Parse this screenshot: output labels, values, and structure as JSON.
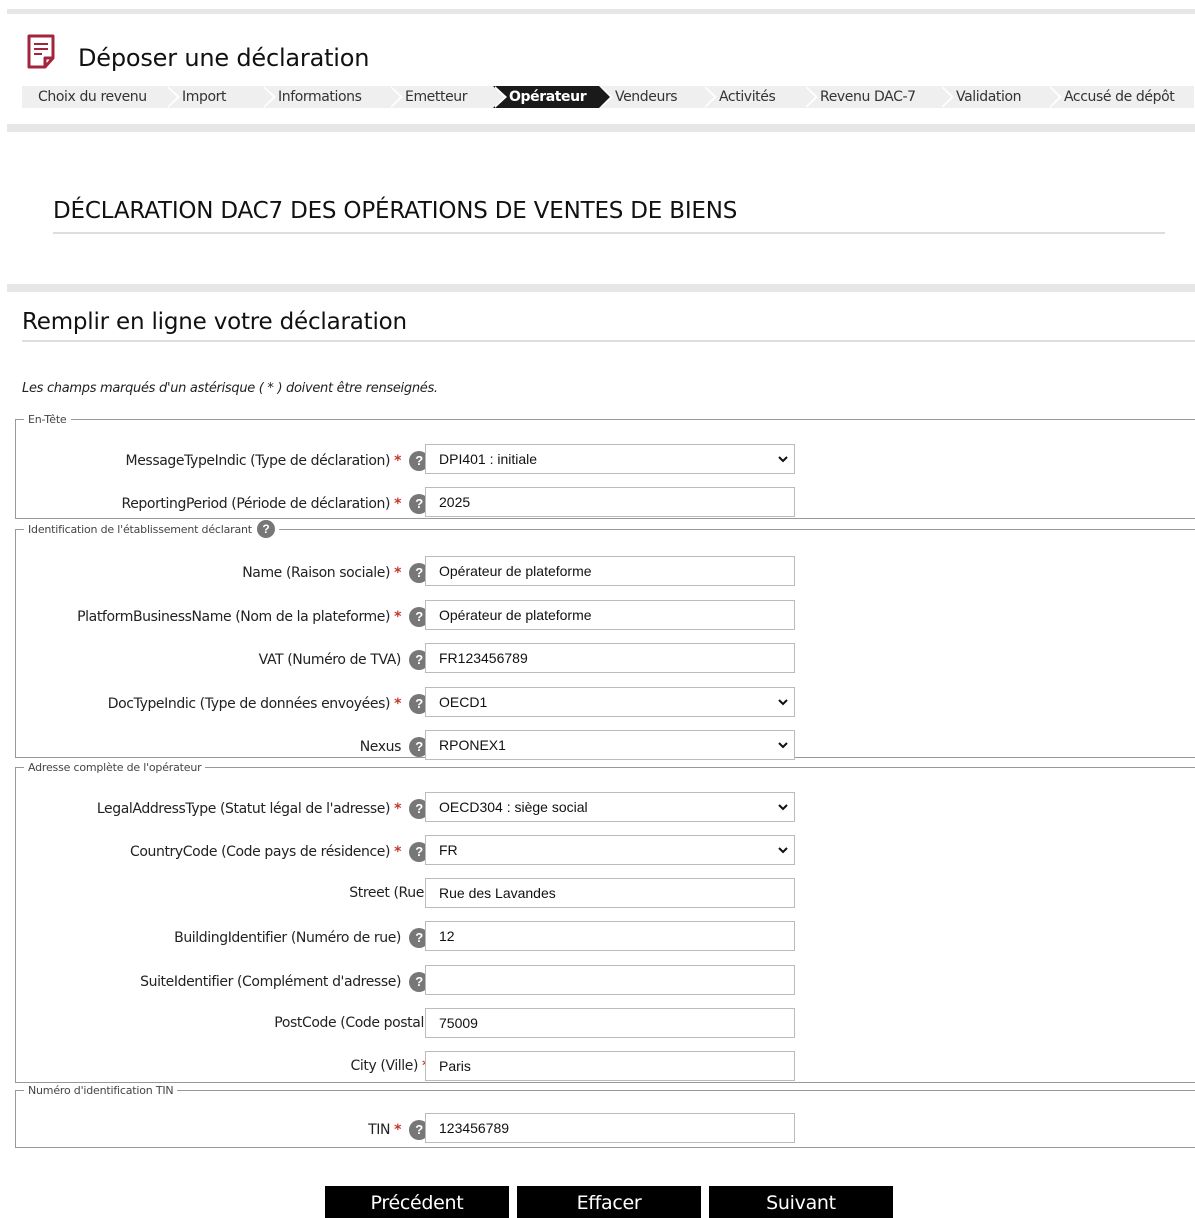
{
  "header": {
    "title": "Déposer une déclaration",
    "icon": "document-icon",
    "accent": "#a3243b"
  },
  "steps": [
    {
      "label": "Choix du revenu"
    },
    {
      "label": "Import"
    },
    {
      "label": "Informations"
    },
    {
      "label": "Emetteur"
    },
    {
      "label": "Opérateur"
    },
    {
      "label": "Vendeurs"
    },
    {
      "label": "Activités"
    },
    {
      "label": "Revenu DAC-7"
    },
    {
      "label": "Validation"
    },
    {
      "label": "Accusé de dépôt"
    }
  ],
  "active_step": "Opérateur",
  "section_title": "DÉCLARATION DAC7 DES OPÉRATIONS DE VENTES DE BIENS",
  "form_title": "Remplir en ligne votre déclaration",
  "required_note": "Les champs marqués d'un astérisque ( * ) doivent être renseignés.",
  "fieldsets": {
    "entete": {
      "legend": "En-Tête",
      "message_type": {
        "label": "MessageTypeIndic (Type de déclaration)",
        "value": "DPI401 : initiale"
      },
      "reporting_period": {
        "label": "ReportingPeriod (Période de déclaration)",
        "value": "2025"
      }
    },
    "identification": {
      "legend": "Identification de l'établissement déclarant",
      "name": {
        "label": "Name (Raison sociale)",
        "value": "Opérateur de plateforme"
      },
      "platform_name": {
        "label": "PlatformBusinessName (Nom de la plateforme)",
        "value": "Opérateur de plateforme"
      },
      "vat": {
        "label": "VAT (Numéro de TVA)",
        "value": "FR123456789"
      },
      "doc_type": {
        "label": "DocTypeIndic (Type de données envoyées)",
        "value": "OECD1"
      },
      "nexus": {
        "label": "Nexus",
        "value": "RPONEX1"
      }
    },
    "adresse": {
      "legend": "Adresse complète de l'opérateur",
      "legal_address_type": {
        "label": "LegalAddressType (Statut légal de l'adresse)",
        "value": "OECD304 : siège social"
      },
      "country_code": {
        "label": "CountryCode (Code pays de résidence)",
        "value": "FR"
      },
      "street": {
        "label": "Street (Rue)",
        "value": "Rue des Lavandes"
      },
      "building": {
        "label": "BuildingIdentifier (Numéro de rue)",
        "value": "12"
      },
      "suite": {
        "label": "SuiteIdentifier (Complément d'adresse)",
        "value": ""
      },
      "postcode": {
        "label": "PostCode (Code postal)",
        "value": "75009"
      },
      "city": {
        "label": "City (Ville)",
        "value": "Paris"
      }
    },
    "tin": {
      "legend": "Numéro d'identification TIN",
      "tin": {
        "label": "TIN",
        "value": "123456789"
      }
    }
  },
  "required_marker": "*",
  "help_glyph": "?",
  "buttons": {
    "previous": "Précédent",
    "clear": "Effacer",
    "next": "Suivant"
  }
}
